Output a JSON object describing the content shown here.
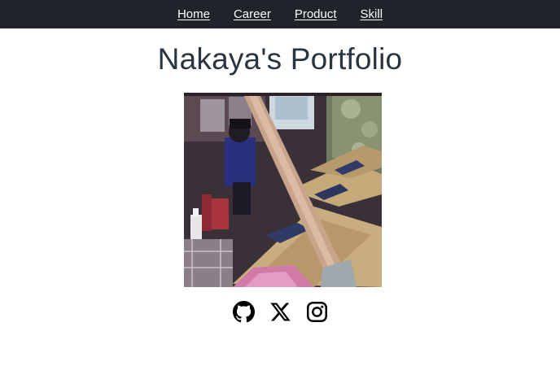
{
  "nav": {
    "items": [
      {
        "label": "Home"
      },
      {
        "label": "Career"
      },
      {
        "label": "Product"
      },
      {
        "label": "Skill"
      }
    ]
  },
  "header": {
    "title": "Nakaya's Portfolio"
  },
  "profile": {
    "photo_icon": "profile-photo"
  },
  "social": {
    "links": [
      {
        "icon": "github-icon"
      },
      {
        "icon": "x-icon"
      },
      {
        "icon": "instagram-icon"
      }
    ]
  },
  "colors": {
    "navbar_bg": "#202329",
    "nav_text": "#ffffff",
    "title_text": "#2a3542",
    "page_bg": "#ffffff"
  }
}
